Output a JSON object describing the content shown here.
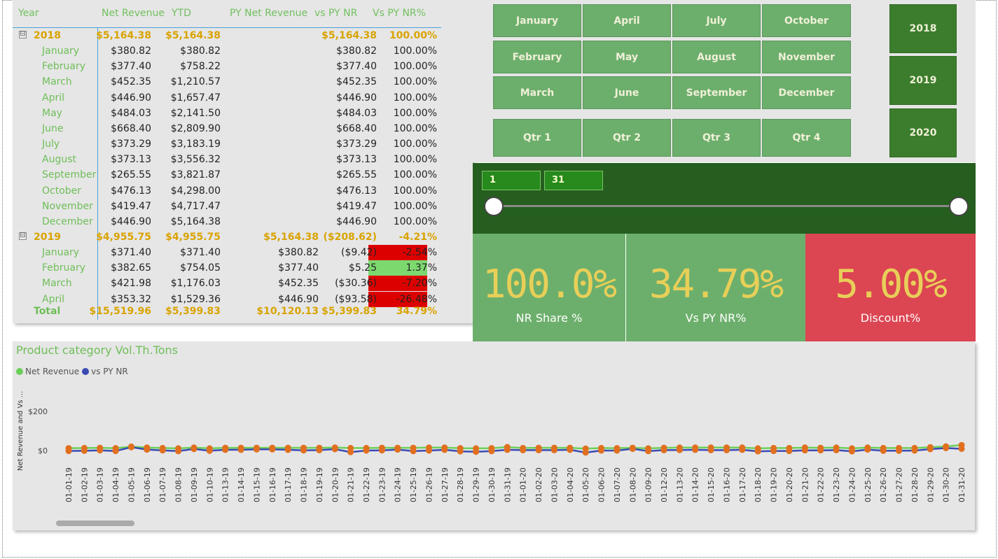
{
  "matrix": {
    "headers": [
      "Year",
      "Net Revenue",
      "YTD",
      "PY Net Revenue",
      "vs PY NR",
      "Vs PY NR%"
    ],
    "rows": [
      {
        "type": "year",
        "label": "2018",
        "nr": "$5,164.38",
        "ytd": "$5,164.38",
        "py": "",
        "vs": "$5,164.38",
        "pct": "100.00%",
        "expander": "⊟"
      },
      {
        "type": "month",
        "label": "January",
        "nr": "$380.82",
        "ytd": "$380.82",
        "py": "",
        "vs": "$380.82",
        "pct": "100.00%"
      },
      {
        "type": "month",
        "label": "February",
        "nr": "$377.40",
        "ytd": "$758.22",
        "py": "",
        "vs": "$377.40",
        "pct": "100.00%"
      },
      {
        "type": "month",
        "label": "March",
        "nr": "$452.35",
        "ytd": "$1,210.57",
        "py": "",
        "vs": "$452.35",
        "pct": "100.00%"
      },
      {
        "type": "month",
        "label": "April",
        "nr": "$446.90",
        "ytd": "$1,657.47",
        "py": "",
        "vs": "$446.90",
        "pct": "100.00%"
      },
      {
        "type": "month",
        "label": "May",
        "nr": "$484.03",
        "ytd": "$2,141.50",
        "py": "",
        "vs": "$484.03",
        "pct": "100.00%"
      },
      {
        "type": "month",
        "label": "June",
        "nr": "$668.40",
        "ytd": "$2,809.90",
        "py": "",
        "vs": "$668.40",
        "pct": "100.00%"
      },
      {
        "type": "month",
        "label": "July",
        "nr": "$373.29",
        "ytd": "$3,183.19",
        "py": "",
        "vs": "$373.29",
        "pct": "100.00%"
      },
      {
        "type": "month",
        "label": "August",
        "nr": "$373.13",
        "ytd": "$3,556.32",
        "py": "",
        "vs": "$373.13",
        "pct": "100.00%"
      },
      {
        "type": "month",
        "label": "September",
        "nr": "$265.55",
        "ytd": "$3,821.87",
        "py": "",
        "vs": "$265.55",
        "pct": "100.00%"
      },
      {
        "type": "month",
        "label": "October",
        "nr": "$476.13",
        "ytd": "$4,298.00",
        "py": "",
        "vs": "$476.13",
        "pct": "100.00%"
      },
      {
        "type": "month",
        "label": "November",
        "nr": "$419.47",
        "ytd": "$4,717.47",
        "py": "",
        "vs": "$419.47",
        "pct": "100.00%"
      },
      {
        "type": "month",
        "label": "December",
        "nr": "$446.90",
        "ytd": "$5,164.38",
        "py": "",
        "vs": "$446.90",
        "pct": "100.00%"
      },
      {
        "type": "year",
        "label": "2019",
        "nr": "$4,955.75",
        "ytd": "$4,955.75",
        "py": "$5,164.38",
        "vs": "($208.62)",
        "pct": "-4.21%",
        "expander": "⊟"
      },
      {
        "type": "month",
        "label": "January",
        "nr": "$371.40",
        "ytd": "$371.40",
        "py": "$380.82",
        "vs": "($9.42)",
        "pct": "-2.54%",
        "status": "negative"
      },
      {
        "type": "month",
        "label": "February",
        "nr": "$382.65",
        "ytd": "$754.05",
        "py": "$377.40",
        "vs": "$5.25",
        "pct": "1.37%",
        "status": "positive"
      },
      {
        "type": "month",
        "label": "March",
        "nr": "$421.98",
        "ytd": "$1,176.03",
        "py": "$452.35",
        "vs": "($30.36)",
        "pct": "-7.20%",
        "status": "negative"
      },
      {
        "type": "month",
        "label": "April",
        "nr": "$353.32",
        "ytd": "$1,529.36",
        "py": "$446.90",
        "vs": "($93.58)",
        "pct": "-26.48%",
        "status": "negative"
      }
    ],
    "total": {
      "label": "Total",
      "nr": "$15,519.96",
      "ytd": "$5,399.83",
      "py": "$10,120.13",
      "vs": "$5,399.83",
      "pct": "34.79%"
    },
    "colors": {
      "negative": "#dd0000",
      "positive": "#7cd96e",
      "header": "#72c05f",
      "year": "#d9a300"
    }
  },
  "months": {
    "col1": [
      "January",
      "February",
      "March"
    ],
    "col2": [
      "April",
      "May",
      "June"
    ],
    "col3": [
      "July",
      "August",
      "September"
    ],
    "col4": [
      "October",
      "November",
      "December"
    ],
    "quarters": [
      "Qtr 1",
      "Qtr 2",
      "Qtr 3",
      "Qtr 4"
    ]
  },
  "years": [
    "2018",
    "2019",
    "2020"
  ],
  "slider": {
    "start": "1",
    "end": "31",
    "start_value": 1,
    "end_value": 31,
    "range": [
      1,
      31
    ]
  },
  "kpis": [
    {
      "value": "100.0%",
      "caption": "NR Share %",
      "color": "#6caf6c"
    },
    {
      "value": "34.79%",
      "caption": "Vs PY NR%",
      "color": "#6caf6c"
    },
    {
      "value": "5.00%",
      "caption": "Discount%",
      "color": "#dc4552"
    }
  ],
  "chart": {
    "title": "Product category Vol.Th.Tons",
    "legend": [
      {
        "name": "Net Revenue",
        "color": "#6ccf5a"
      },
      {
        "name": "vs PY NR",
        "color": "#3b4bb3"
      }
    ],
    "ylabel": "Net Revenue and Vs ...",
    "yticks": [
      "$200",
      "$0"
    ]
  },
  "chart_data": {
    "type": "line",
    "x": [
      "01-01-19",
      "01-02-19",
      "01-03-19",
      "01-04-19",
      "01-05-19",
      "01-06-19",
      "01-07-19",
      "01-08-19",
      "01-09-19",
      "01-10-19",
      "01-13-19",
      "01-14-19",
      "01-15-19",
      "01-16-19",
      "01-17-19",
      "01-18-19",
      "01-19-19",
      "01-20-19",
      "01-21-19",
      "01-22-19",
      "01-23-19",
      "01-24-19",
      "01-25-19",
      "01-26-19",
      "01-27-19",
      "01-28-19",
      "01-29-19",
      "01-30-19",
      "01-31-19",
      "01-01-20",
      "01-02-20",
      "01-03-20",
      "01-04-20",
      "01-05-20",
      "01-06-20",
      "01-07-20",
      "01-08-20",
      "01-09-20",
      "01-12-20",
      "01-13-20",
      "01-14-20",
      "01-15-20",
      "01-16-20",
      "01-17-20",
      "01-18-20",
      "01-19-20",
      "01-20-20",
      "01-21-20",
      "01-22-20",
      "01-23-20",
      "01-24-20",
      "01-25-20",
      "01-26-20",
      "01-27-20",
      "01-28-20",
      "01-29-20",
      "01-30-20",
      "01-31-20"
    ],
    "series": [
      {
        "name": "Net Revenue",
        "color": "#6ccf5a",
        "values": [
          12,
          13,
          14,
          12,
          20,
          15,
          13,
          11,
          15,
          11,
          14,
          14,
          14,
          14,
          14,
          14,
          14,
          15,
          13,
          13,
          14,
          14,
          14,
          15,
          15,
          12,
          11,
          12,
          18,
          13,
          14,
          14,
          14,
          10,
          13,
          12,
          14,
          11,
          14,
          15,
          15,
          15,
          15,
          15,
          11,
          13,
          13,
          15,
          14,
          15,
          11,
          15,
          13,
          13,
          13,
          17,
          21,
          28
        ]
      },
      {
        "name": "vs PY NR",
        "color": "#3b4bb3",
        "values": [
          -2,
          -1,
          1,
          -2,
          17,
          5,
          1,
          -3,
          8,
          -1,
          4,
          4,
          6,
          6,
          4,
          1,
          2,
          7,
          -8,
          0,
          1,
          5,
          -3,
          0,
          4,
          -4,
          -6,
          -3,
          4,
          2,
          2,
          2,
          4,
          -10,
          0,
          0,
          9,
          -3,
          2,
          3,
          4,
          2,
          2,
          4,
          -4,
          -2,
          -2,
          1,
          1,
          2,
          -4,
          5,
          -1,
          -1,
          0,
          7,
          13,
          9
        ]
      }
    ],
    "xlabel": "",
    "ylabel": "Net Revenue and Vs ...",
    "ylim": [
      -40,
      260
    ],
    "yticks": [
      0,
      200
    ],
    "grid": false,
    "legend_position": "top-left"
  }
}
